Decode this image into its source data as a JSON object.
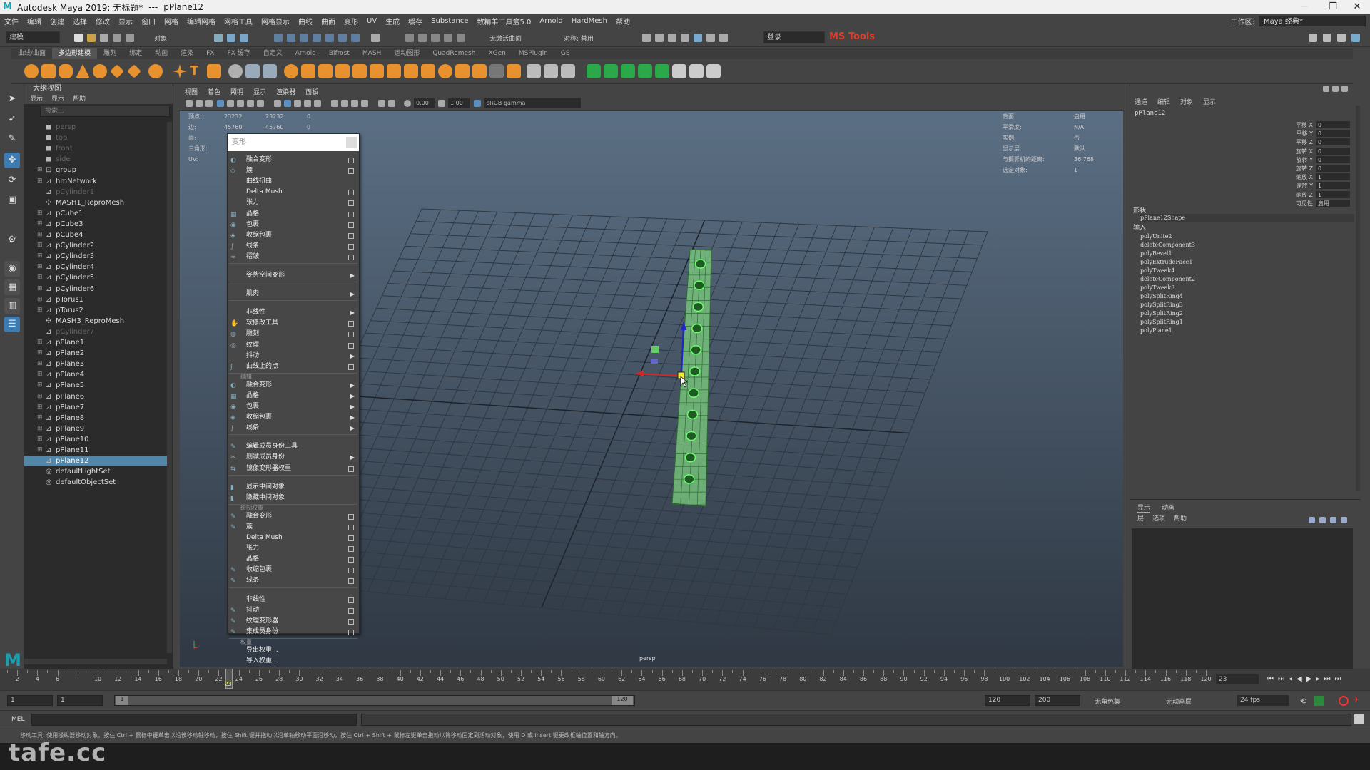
{
  "window": {
    "app_title": "Autodesk Maya 2019: 无标题*",
    "separator": "---",
    "object": "pPlane12"
  },
  "menubar": {
    "items": [
      "文件",
      "编辑",
      "创建",
      "选择",
      "修改",
      "显示",
      "窗口",
      "网格",
      "编辑网格",
      "网格工具",
      "网格显示",
      "曲线",
      "曲面",
      "变形",
      "UV",
      "生成",
      "缓存",
      "Substance",
      "致精羊工具盒5.0",
      "Arnold",
      "HardMesh",
      "帮助"
    ],
    "workspace_label": "工作区:",
    "workspace_value": "Maya 经典*"
  },
  "statusline": {
    "mode": "建模",
    "objects_label": "对象",
    "symmetry": "对称: 禁用",
    "live_surface": "无激活曲面",
    "login": "登录",
    "plugin": "MS Tools"
  },
  "shelf": {
    "tabs": [
      "曲线/曲面",
      "多边形建模",
      "雕刻",
      "绑定",
      "动画",
      "渲染",
      "FX",
      "FX 缓存",
      "自定义",
      "Arnold",
      "Bifrost",
      "MASH",
      "运动图形",
      "QuadRemesh",
      "XGen",
      "MSPlugin",
      "GS"
    ],
    "active_tab": "多边形建模"
  },
  "outliner": {
    "title": "大纲视图",
    "menu": [
      "显示",
      "显示",
      "帮助"
    ],
    "search_placeholder": "搜索...",
    "items": [
      {
        "label": "persp",
        "dim": true,
        "icon": "camera"
      },
      {
        "label": "top",
        "dim": true,
        "icon": "camera"
      },
      {
        "label": "front",
        "dim": true,
        "icon": "camera"
      },
      {
        "label": "side",
        "dim": true,
        "icon": "camera"
      },
      {
        "label": "group",
        "dim": false,
        "icon": "group",
        "exp": true
      },
      {
        "label": "hmNetwork",
        "dim": false,
        "icon": "mesh",
        "exp": true
      },
      {
        "label": "pCylinder1",
        "dim": true,
        "icon": "mesh"
      },
      {
        "label": "MASH1_ReproMesh",
        "dim": false,
        "icon": "mash"
      },
      {
        "label": "pCube1",
        "dim": false,
        "icon": "mesh",
        "exp": true
      },
      {
        "label": "pCube3",
        "dim": false,
        "icon": "mesh",
        "exp": true
      },
      {
        "label": "pCube4",
        "dim": false,
        "icon": "mesh",
        "exp": true
      },
      {
        "label": "pCylinder2",
        "dim": false,
        "icon": "mesh",
        "exp": true
      },
      {
        "label": "pCylinder3",
        "dim": false,
        "icon": "mesh",
        "exp": true
      },
      {
        "label": "pCylinder4",
        "dim": false,
        "icon": "mesh",
        "exp": true
      },
      {
        "label": "pCylinder5",
        "dim": false,
        "icon": "mesh",
        "exp": true
      },
      {
        "label": "pCylinder6",
        "dim": false,
        "icon": "mesh",
        "exp": true
      },
      {
        "label": "pTorus1",
        "dim": false,
        "icon": "mesh",
        "exp": true
      },
      {
        "label": "pTorus2",
        "dim": false,
        "icon": "mesh",
        "exp": true
      },
      {
        "label": "MASH3_ReproMesh",
        "dim": false,
        "icon": "mash"
      },
      {
        "label": "pCylinder7",
        "dim": true,
        "icon": "mesh"
      },
      {
        "label": "pPlane1",
        "dim": false,
        "icon": "mesh",
        "exp": true
      },
      {
        "label": "pPlane2",
        "dim": false,
        "icon": "mesh",
        "exp": true
      },
      {
        "label": "pPlane3",
        "dim": false,
        "icon": "mesh",
        "exp": true
      },
      {
        "label": "pPlane4",
        "dim": false,
        "icon": "mesh",
        "exp": true
      },
      {
        "label": "pPlane5",
        "dim": false,
        "icon": "mesh",
        "exp": true
      },
      {
        "label": "pPlane6",
        "dim": false,
        "icon": "mesh",
        "exp": true
      },
      {
        "label": "pPlane7",
        "dim": false,
        "icon": "mesh",
        "exp": true
      },
      {
        "label": "pPlane8",
        "dim": false,
        "icon": "mesh",
        "exp": true
      },
      {
        "label": "pPlane9",
        "dim": false,
        "icon": "mesh",
        "exp": true
      },
      {
        "label": "pPlane10",
        "dim": false,
        "icon": "mesh",
        "exp": true
      },
      {
        "label": "pPlane11",
        "dim": false,
        "icon": "mesh",
        "exp": true
      },
      {
        "label": "pPlane12",
        "dim": false,
        "icon": "mesh",
        "selected": true
      },
      {
        "label": "defaultLightSet",
        "dim": false,
        "icon": "set"
      },
      {
        "label": "defaultObjectSet",
        "dim": false,
        "icon": "set"
      }
    ]
  },
  "viewport": {
    "menu": [
      "视图",
      "着色",
      "照明",
      "显示",
      "渲染器",
      "面板"
    ],
    "exposure": "0.00",
    "gamma": "1.00",
    "color_space": "sRGB gamma",
    "camera_label": "persp",
    "hud_left": [
      {
        "label": "顶点:",
        "v1": "23232",
        "v2": "23232",
        "v3": "0"
      },
      {
        "label": "边:",
        "v1": "45760",
        "v2": "45760",
        "v3": "0"
      },
      {
        "label": "面:",
        "v1": "",
        "v2": "",
        "v3": ""
      },
      {
        "label": "三角形:",
        "v1": "",
        "v2": "",
        "v3": ""
      },
      {
        "label": "UV:",
        "v1": "",
        "v2": "",
        "v3": ""
      }
    ],
    "hud_right": [
      {
        "label": "背面:",
        "value": "启用"
      },
      {
        "label": "平滑度:",
        "value": "N/A"
      },
      {
        "label": "实例:",
        "value": "否"
      },
      {
        "label": "显示层:",
        "value": "默认"
      },
      {
        "label": "与摄影机的距离:",
        "value": "36.768"
      },
      {
        "label": "选定对象:",
        "value": "1"
      }
    ]
  },
  "deform_menu": {
    "title": "变形",
    "rows": [
      {
        "label": "融合变形",
        "type": "option",
        "icon": "◐"
      },
      {
        "label": "簇",
        "type": "option",
        "icon": "◇"
      },
      {
        "label": "曲线扭曲",
        "type": "plain",
        "icon": ""
      },
      {
        "label": "Delta Mush",
        "type": "option",
        "icon": ""
      },
      {
        "label": "张力",
        "type": "option",
        "icon": ""
      },
      {
        "label": "晶格",
        "type": "option",
        "icon": "▦"
      },
      {
        "label": "包裹",
        "type": "option",
        "icon": "◉"
      },
      {
        "label": "收缩包裹",
        "type": "option",
        "icon": "◈"
      },
      {
        "label": "线条",
        "type": "option",
        "icon": "∫"
      },
      {
        "label": "褶皱",
        "type": "option",
        "icon": "≈"
      },
      {
        "label": "姿势空间变形",
        "type": "submenu",
        "icon": ""
      },
      {
        "label": "肌肉",
        "type": "submenu",
        "icon": ""
      },
      {
        "label": "非线性",
        "type": "submenu",
        "icon": ""
      },
      {
        "label": "软修改工具",
        "type": "option",
        "icon": "✋"
      },
      {
        "label": "雕刻",
        "type": "option",
        "icon": "◍"
      },
      {
        "label": "纹理",
        "type": "option",
        "icon": "◎"
      },
      {
        "label": "抖动",
        "type": "submenu",
        "icon": ""
      },
      {
        "label": "曲线上的点",
        "type": "option",
        "icon": "ʃ"
      }
    ],
    "section_edit": "编辑",
    "edit_rows": [
      {
        "label": "融合变形",
        "type": "submenu"
      },
      {
        "label": "晶格",
        "type": "submenu"
      },
      {
        "label": "包裹",
        "type": "submenu"
      },
      {
        "label": "收缩包裹",
        "type": "submenu"
      },
      {
        "label": "线条",
        "type": "submenu"
      },
      {
        "label": "编辑成员身份工具",
        "type": "plain"
      },
      {
        "label": "删减成员身份",
        "type": "submenu"
      },
      {
        "label": "镜像变形器权重",
        "type": "option"
      },
      {
        "label": "显示中间对象",
        "type": "plain"
      },
      {
        "label": "隐藏中间对象",
        "type": "plain"
      }
    ],
    "section_paint": "绘制权重",
    "paint_rows": [
      {
        "label": "融合变形",
        "type": "option"
      },
      {
        "label": "簇",
        "type": "option"
      },
      {
        "label": "Delta Mush",
        "type": "option"
      },
      {
        "label": "张力",
        "type": "option"
      },
      {
        "label": "晶格",
        "type": "option"
      },
      {
        "label": "收缩包裹",
        "type": "option"
      },
      {
        "label": "线条",
        "type": "option"
      },
      {
        "label": "非线性",
        "type": "option"
      },
      {
        "label": "抖动",
        "type": "option"
      },
      {
        "label": "纹理变形器",
        "type": "option"
      },
      {
        "label": "集成员身份",
        "type": "option"
      }
    ],
    "section_weights": "权重",
    "weight_rows": [
      "导出权重...",
      "导入权重..."
    ]
  },
  "channel_box": {
    "menu": [
      "通道",
      "编辑",
      "对象",
      "显示"
    ],
    "object_name": "pPlane12",
    "attributes": [
      {
        "name": "平移 X",
        "value": "0"
      },
      {
        "name": "平移 Y",
        "value": "0"
      },
      {
        "name": "平移 Z",
        "value": "0"
      },
      {
        "name": "旋转 X",
        "value": "0"
      },
      {
        "name": "旋转 Y",
        "value": "0"
      },
      {
        "name": "旋转 Z",
        "value": "0"
      },
      {
        "name": "缩放 X",
        "value": "1"
      },
      {
        "name": "缩放 Y",
        "value": "1"
      },
      {
        "name": "缩放 Z",
        "value": "1"
      },
      {
        "name": "可见性",
        "value": "启用"
      }
    ],
    "shapes_label": "形状",
    "shape_name": "pPlane12Shape",
    "inputs_label": "输入",
    "inputs": [
      "polyUnite2",
      "deleteComponent3",
      "polyBevel1",
      "polyExtrudeFace1",
      "polyTweak4",
      "deleteComponent2",
      "polyTweak3",
      "polySplitRing4",
      "polySplitRing3",
      "polySplitRing2",
      "polySplitRing1",
      "polyPlane1"
    ]
  },
  "layer_panel": {
    "tabs": [
      "显示",
      "动画"
    ],
    "menu": [
      "层",
      "选项",
      "帮助"
    ]
  },
  "timeline": {
    "ticks": [
      "2",
      "4",
      "6",
      "10",
      "12",
      "14",
      "16",
      "18",
      "20",
      "22",
      "24",
      "26",
      "28",
      "30",
      "32",
      "34",
      "36",
      "38",
      "40",
      "42",
      "44",
      "46",
      "48",
      "50",
      "52",
      "54",
      "56",
      "58",
      "60",
      "62",
      "64",
      "66",
      "68",
      "70",
      "72",
      "74",
      "76",
      "78",
      "80",
      "82",
      "84",
      "86",
      "88",
      "90",
      "92",
      "94",
      "96",
      "98",
      "100",
      "102",
      "104",
      "106",
      "108",
      "110",
      "112",
      "114",
      "116",
      "118",
      "120"
    ],
    "current_frame": "23",
    "frame_field": "23"
  },
  "range": {
    "start": "1",
    "start2": "1",
    "slider_start": "1",
    "slider_end": "120",
    "end": "120",
    "end2": "200",
    "character_set": "无角色集",
    "anim_layer": "无动画层",
    "fps": "24 fps"
  },
  "cmdline": {
    "label": "MEL"
  },
  "helpline": {
    "text": "移动工具: 使用操纵器移动对象。按住 Ctrl + 鼠标中键单击以沿该移动轴移动，按住 Shift 键并拖动以沿单轴移动平面沿移动，按住 Ctrl + Shift + 鼠标左键单击拖动以将移动固定到活动对象，使用 D 或 insert 键更改枢轴位置和轴方向。"
  },
  "watermark": "tafe.cc",
  "colors": {
    "selection": "#5285a6",
    "plugin_red": "#e23b2a",
    "active_tab": "#555555"
  }
}
